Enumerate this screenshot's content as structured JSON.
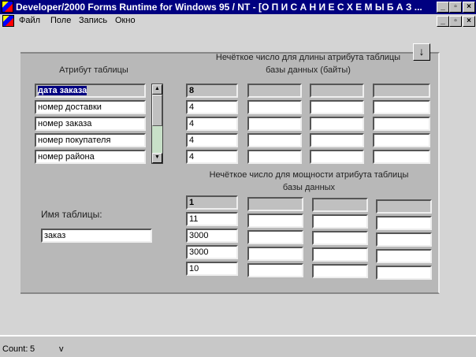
{
  "window": {
    "title": "Developer/2000 Forms Runtime for Windows 95 / NT - [О П И С А Н И Е     С Х Е М Ы     Б А З ..."
  },
  "menu": [
    {
      "label": "Файл"
    },
    {
      "label": "Поле"
    },
    {
      "label": "Запись"
    },
    {
      "label": "Окно"
    }
  ],
  "left": {
    "header": "Атрибут таблицы",
    "attributes": [
      "дата заказа",
      "номер доставки",
      "номер заказа",
      "номер покупателя",
      "номер района"
    ]
  },
  "length_block": {
    "header_line1": "Нечёткое число для длины атрибута таблицы",
    "header_line2": "базы данных  (байты)",
    "rows": [
      [
        "8",
        "",
        "",
        ""
      ],
      [
        "4",
        "",
        "",
        ""
      ],
      [
        "4",
        "",
        "",
        ""
      ],
      [
        "4",
        "",
        "",
        ""
      ],
      [
        "4",
        "",
        "",
        ""
      ]
    ]
  },
  "power_block": {
    "header_line1": "Нечёткое число для мощности атрибута таблицы",
    "header_line2": "базы данных",
    "rows": [
      [
        "1",
        "",
        "",
        ""
      ],
      [
        "11",
        "",
        "",
        ""
      ],
      [
        "3000",
        "",
        "",
        ""
      ],
      [
        "3000",
        "",
        "",
        ""
      ],
      [
        "10",
        "",
        "",
        ""
      ]
    ]
  },
  "table_name": {
    "label": "Имя таблицы:",
    "value": "заказ"
  },
  "status": {
    "count_label": "Count:",
    "count": "5",
    "indicator": "v"
  }
}
